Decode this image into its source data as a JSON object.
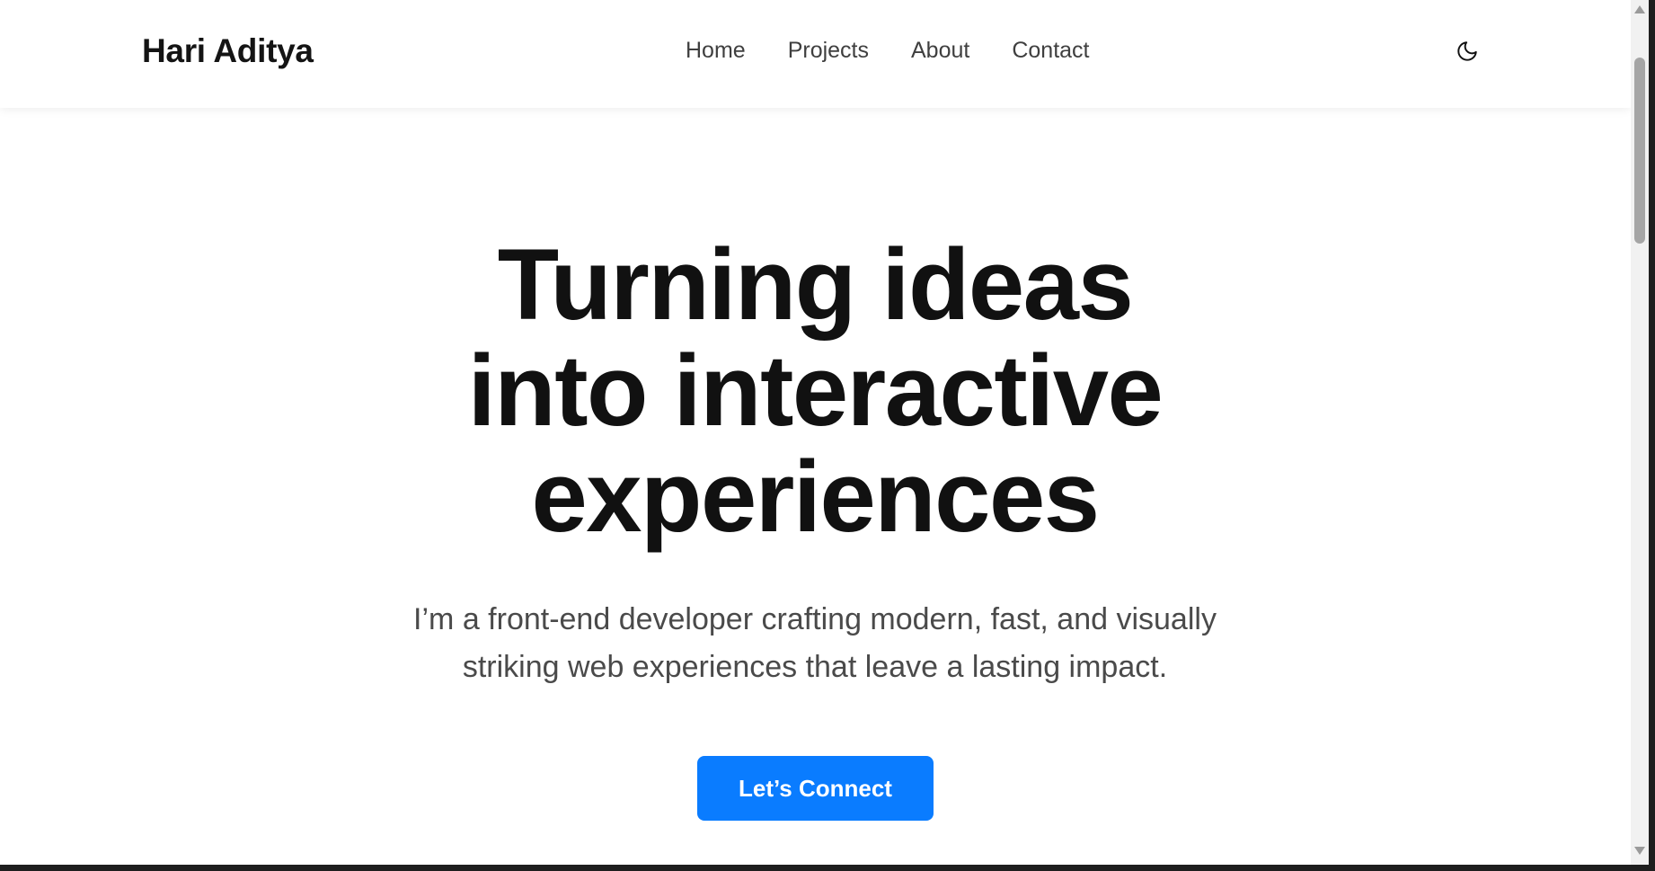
{
  "navbar": {
    "brand": "Hari Aditya",
    "links": [
      {
        "label": "Home"
      },
      {
        "label": "Projects"
      },
      {
        "label": "About"
      },
      {
        "label": "Contact"
      }
    ],
    "theme_toggle_icon": "moon-icon"
  },
  "hero": {
    "title_lines": [
      "Turning ideas",
      "into interactive",
      "experiences"
    ],
    "subtitle_lines": [
      "I’m a front-end developer crafting modern, fast, and visually",
      "striking web experiences that leave a lasting impact."
    ],
    "cta_label": "Let’s Connect"
  },
  "colors": {
    "accent": "#0a7cff",
    "text_primary": "#111111",
    "text_secondary": "#4a4a4a",
    "background": "#ffffff"
  }
}
